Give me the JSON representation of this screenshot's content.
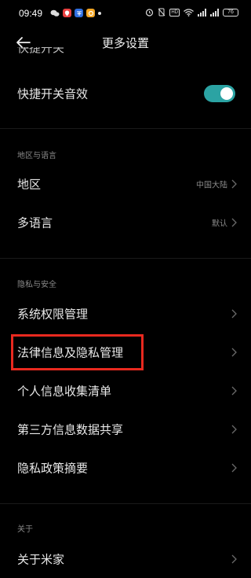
{
  "status_bar": {
    "time": "09:49",
    "battery": "76",
    "hd": "HD"
  },
  "header": {
    "title": "更多设置"
  },
  "clipped_item": {
    "label": "快捷开关"
  },
  "rows_top": [
    {
      "label": "快捷开关音效",
      "toggle_on": true
    }
  ],
  "sections": {
    "region_language": {
      "title": "地区与语言",
      "items": [
        {
          "label": "地区",
          "value": "中国大陆"
        },
        {
          "label": "多语言",
          "value": "默认"
        }
      ]
    },
    "privacy_security": {
      "title": "隐私与安全",
      "items": [
        {
          "label": "系统权限管理"
        },
        {
          "label": "法律信息及隐私管理"
        },
        {
          "label": "个人信息收集清单"
        },
        {
          "label": "第三方信息数据共享"
        },
        {
          "label": "隐私政策摘要"
        }
      ]
    },
    "about": {
      "title": "关于",
      "items": [
        {
          "label": "关于米家"
        }
      ]
    }
  },
  "colors": {
    "background": "#000000",
    "toggle_on": "#2ba3a3",
    "highlight": "#e8291f",
    "secondary_text": "#8a8a8a"
  }
}
